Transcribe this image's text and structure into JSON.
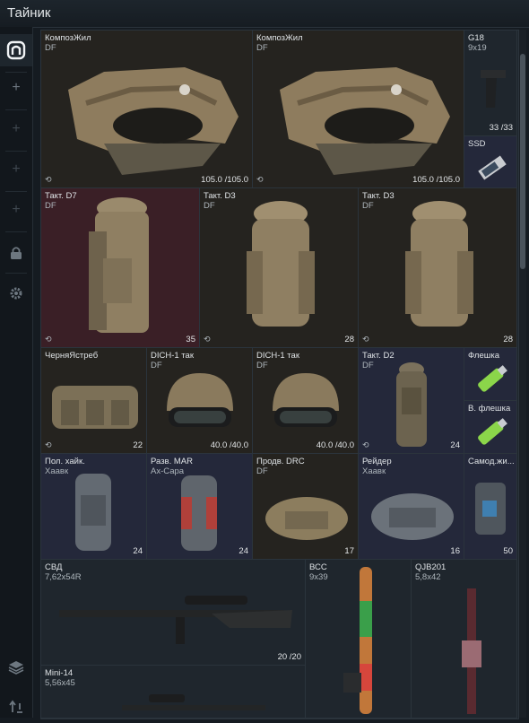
{
  "window": {
    "title": "Тайник",
    "ghost": ""
  },
  "sidebar": {
    "items": [
      {
        "name": "stash-icon",
        "glyph": "⌂"
      },
      {
        "name": "add-slot-1",
        "glyph": "+"
      },
      {
        "name": "add-slot-2",
        "glyph": "+"
      },
      {
        "name": "add-slot-3",
        "glyph": "+"
      },
      {
        "name": "add-slot-4",
        "glyph": "+"
      },
      {
        "name": "lock-icon",
        "glyph": "🔒"
      },
      {
        "name": "gear-icon",
        "glyph": "⚙"
      },
      {
        "name": "layers-icon",
        "glyph": "≋"
      },
      {
        "name": "sort-icon",
        "glyph": "⇵"
      }
    ]
  },
  "items": [
    {
      "id": "armor1",
      "name": "КомпозЖил",
      "sub": "DF",
      "value": "105.0 /105.0",
      "mark": "⟲"
    },
    {
      "id": "armor2",
      "name": "КомпозЖил",
      "sub": "DF",
      "value": "105.0 /105.0",
      "mark": "⟲"
    },
    {
      "id": "g18",
      "name": "G18",
      "sub": "9x19",
      "value": "33 /33",
      "mark": ""
    },
    {
      "id": "ssd",
      "name": "SSD",
      "sub": "",
      "value": "",
      "mark": ""
    },
    {
      "id": "d7",
      "name": "Такт. D7",
      "sub": "DF",
      "value": "35",
      "mark": "⟲"
    },
    {
      "id": "d3a",
      "name": "Такт. D3",
      "sub": "DF",
      "value": "28",
      "mark": "⟲"
    },
    {
      "id": "d3b",
      "name": "Такт. D3",
      "sub": "DF",
      "value": "28",
      "mark": "⟲"
    },
    {
      "id": "blackhawk",
      "name": "ЧерняЯстреб",
      "sub": "",
      "value": "22",
      "mark": "⟲"
    },
    {
      "id": "dich1",
      "name": "DICH-1 так",
      "sub": "DF",
      "value": "40.0 /40.0",
      "mark": ""
    },
    {
      "id": "dich2",
      "name": "DICH-1 так",
      "sub": "DF",
      "value": "40.0 /40.0",
      "mark": ""
    },
    {
      "id": "d2",
      "name": "Такт. D2",
      "sub": "DF",
      "value": "24",
      "mark": "⟲"
    },
    {
      "id": "flash1",
      "name": "Флешка",
      "sub": "",
      "value": "",
      "mark": ""
    },
    {
      "id": "flash2",
      "name": "В. флешка",
      "sub": "",
      "value": "",
      "mark": ""
    },
    {
      "id": "hike",
      "name": "Пол. хайк.",
      "sub": "Хаавк",
      "value": "24",
      "mark": ""
    },
    {
      "id": "mar",
      "name": "Разв. MAR",
      "sub": "Ах-Сара",
      "value": "24",
      "mark": ""
    },
    {
      "id": "drc",
      "name": "Продв. DRC",
      "sub": "DF",
      "value": "17",
      "mark": ""
    },
    {
      "id": "raider",
      "name": "Рейдер",
      "sub": "Хаавк",
      "value": "16",
      "mark": ""
    },
    {
      "id": "samod",
      "name": "Самод.жи...",
      "sub": "",
      "value": "50",
      "mark": ""
    },
    {
      "id": "svd",
      "name": "СВД",
      "sub": "7,62x54R",
      "value": "20 /20",
      "mark": ""
    },
    {
      "id": "vss",
      "name": "ВСС",
      "sub": "9x39",
      "value": "",
      "mark": ""
    },
    {
      "id": "qjb",
      "name": "QJB201",
      "sub": "5,8x42",
      "value": "",
      "mark": ""
    },
    {
      "id": "mini14",
      "name": "Mini-14",
      "sub": "5,56x45",
      "value": "",
      "mark": ""
    }
  ]
}
